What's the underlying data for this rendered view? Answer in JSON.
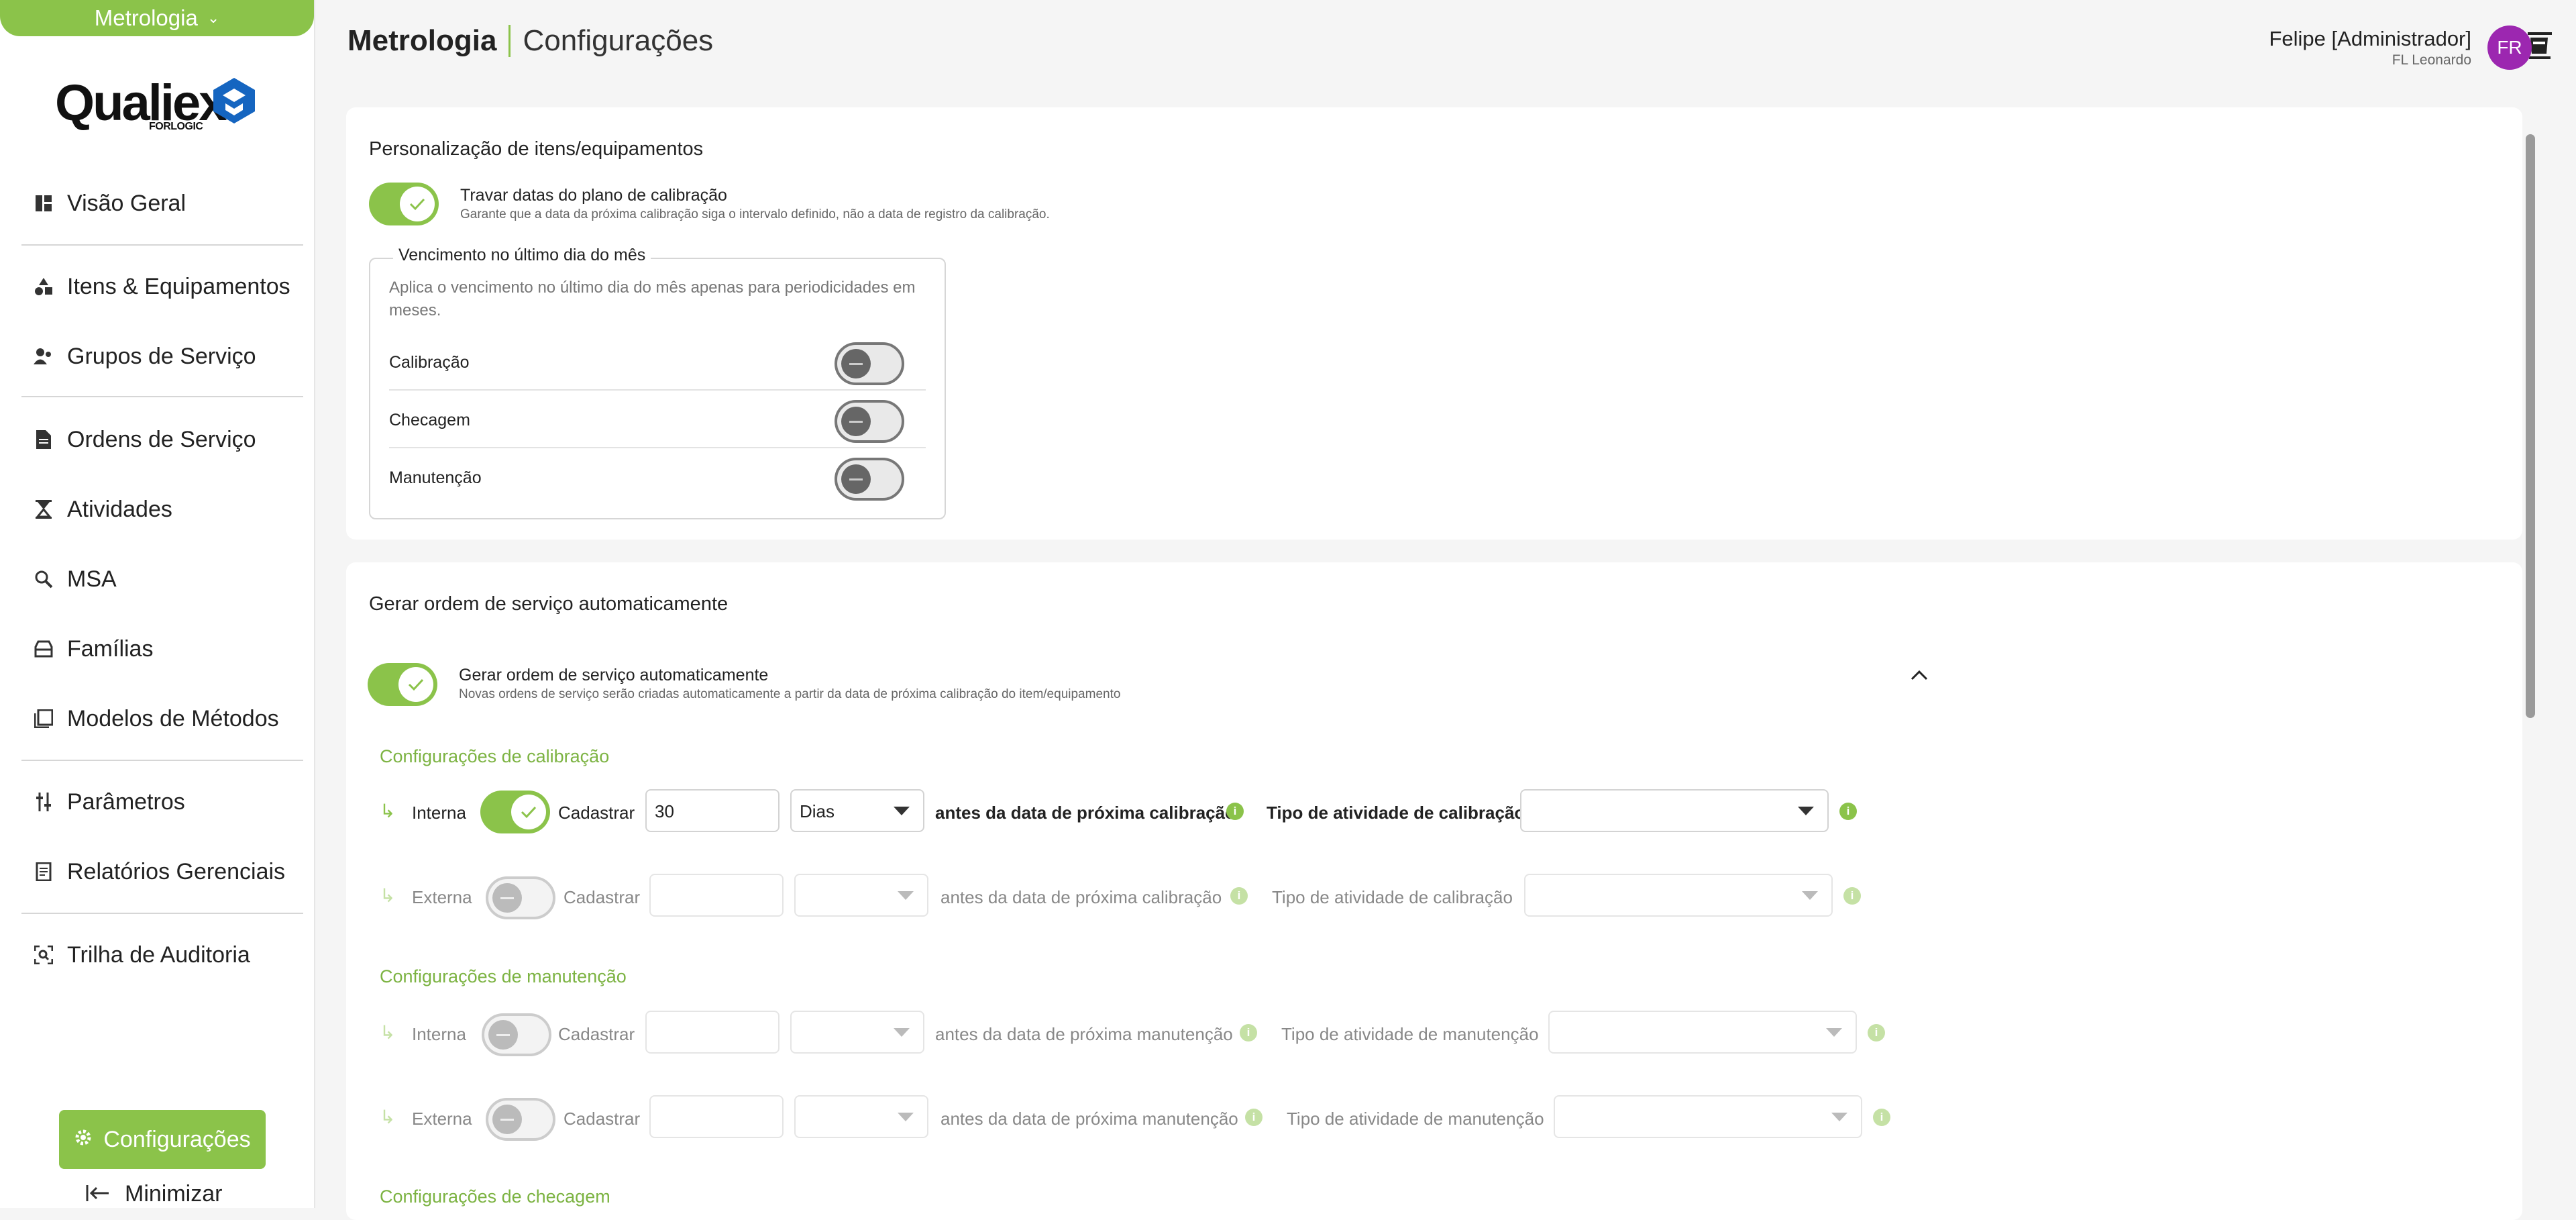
{
  "sidebar": {
    "module_label": "Metrologia",
    "logo_text": "Qualiex",
    "logo_sub": "FORLOGIC",
    "items": [
      {
        "label": "Visão Geral",
        "icon": "dashboard-icon"
      },
      {
        "label": "Itens & Equipamentos",
        "icon": "shapes-icon"
      },
      {
        "label": "Grupos de Serviço",
        "icon": "user-group-icon"
      },
      {
        "label": "Ordens de Serviço",
        "icon": "document-icon"
      },
      {
        "label": "Atividades",
        "icon": "hourglass-icon"
      },
      {
        "label": "MSA",
        "icon": "analysis-icon"
      },
      {
        "label": "Famílias",
        "icon": "cabinet-icon"
      },
      {
        "label": "Modelos de Métodos",
        "icon": "book-icon"
      },
      {
        "label": "Parâmetros",
        "icon": "sliders-icon"
      },
      {
        "label": "Relatórios Gerenciais",
        "icon": "report-icon"
      },
      {
        "label": "Trilha de Auditoria",
        "icon": "audit-icon"
      }
    ],
    "config_label": "Configurações",
    "minimize_label": "Minimizar"
  },
  "header": {
    "module": "Metrologia",
    "page": "Configurações",
    "user_name": "Felipe [Administrador]",
    "user_sub": "FL Leonardo",
    "avatar_initials": "FR",
    "avatar_color": "#9c27b0"
  },
  "card1": {
    "title": "Personalização de itens/equipamentos",
    "lock_label": "Travar datas do plano de calibração",
    "lock_desc": "Garante que a data da próxima calibração siga o intervalo definido, não a data de registro da calibração.",
    "lock_on": true,
    "venc_legend": "Vencimento no último dia do mês",
    "venc_desc": "Aplica o vencimento no último dia do mês apenas para periodicidades em meses.",
    "venc_rows": [
      {
        "label": "Calibração",
        "on": false
      },
      {
        "label": "Checagem",
        "on": false
      },
      {
        "label": "Manutenção",
        "on": false
      }
    ]
  },
  "card2": {
    "title": "Gerar ordem de serviço automaticamente",
    "auto_label": "Gerar ordem de serviço automaticamente",
    "auto_desc": "Novas ordens de serviço serão criadas automaticamente a partir da data de próxima calibração do item/equipamento",
    "auto_on": true,
    "sections": {
      "calibracao": "Configurações de calibração",
      "manutencao": "Configurações de manutenção",
      "checagem": "Configurações de checagem"
    },
    "common": {
      "cadastrar": "Cadastrar"
    },
    "rows": {
      "cal_int": {
        "type": "Interna",
        "on": true,
        "value": "30",
        "unit": "Dias",
        "before": "antes da data de próxima calibração",
        "activity": "Tipo de atividade de calibração",
        "activity_value": ""
      },
      "cal_ext": {
        "type": "Externa",
        "on": false,
        "value": "",
        "unit": "",
        "before": "antes da data de próxima calibração",
        "activity": "Tipo de atividade de calibração",
        "activity_value": ""
      },
      "man_int": {
        "type": "Interna",
        "on": false,
        "value": "",
        "unit": "",
        "before": "antes da data de próxima manutenção",
        "activity": "Tipo de atividade de manutenção",
        "activity_value": ""
      },
      "man_ext": {
        "type": "Externa",
        "on": false,
        "value": "",
        "unit": "",
        "before": "antes da data de próxima manutenção",
        "activity": "Tipo de atividade de manutenção",
        "activity_value": ""
      }
    }
  },
  "colors": {
    "accent": "#8bc34a",
    "section": "#7cb342"
  }
}
